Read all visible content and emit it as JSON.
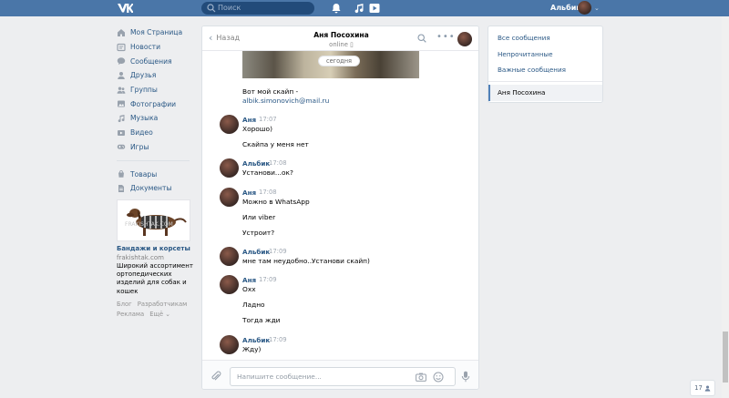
{
  "header": {
    "search_placeholder": "Поиск",
    "user_name": "Альбик"
  },
  "nav": {
    "items": [
      {
        "label": "Моя Страница",
        "icon": "home-icon"
      },
      {
        "label": "Новости",
        "icon": "news-icon"
      },
      {
        "label": "Сообщения",
        "icon": "messages-icon"
      },
      {
        "label": "Друзья",
        "icon": "friends-icon"
      },
      {
        "label": "Группы",
        "icon": "groups-icon"
      },
      {
        "label": "Фотографии",
        "icon": "photos-icon"
      },
      {
        "label": "Музыка",
        "icon": "music-icon"
      },
      {
        "label": "Видео",
        "icon": "video-icon"
      },
      {
        "label": "Игры",
        "icon": "games-icon"
      }
    ],
    "items2": [
      {
        "label": "Товары",
        "icon": "goods-icon"
      },
      {
        "label": "Документы",
        "icon": "documents-icon"
      }
    ]
  },
  "ad": {
    "image_watermark": "FRAKISHTAK.COM",
    "title": "Бандажи и корсеты",
    "domain": "frakishtak.com",
    "text": "Широкий ассортимент ортопедических изделий для собак и кошек"
  },
  "footer": {
    "links": [
      "Блог",
      "Разработчикам",
      "Реклама",
      "Ещё ⌄"
    ]
  },
  "chat": {
    "back_label": "Назад",
    "peer_name": "Аня Посохина",
    "peer_status": "online ▯",
    "date_pill": "сегодня",
    "messages": [
      {
        "text1": "Вот мой скайп -",
        "link": "albik.simonovich@mail.ru"
      },
      {
        "author": "Аня",
        "time": "17:07",
        "lines": [
          "Хорошо)",
          "Скайпа у меня нет"
        ]
      },
      {
        "author": "Альбик",
        "time": "17:08",
        "lines": [
          "Установи...ок?"
        ]
      },
      {
        "author": "Аня",
        "time": "17:08",
        "lines": [
          "Можно в WhatsApp",
          "Или viber",
          "Устроит?"
        ]
      },
      {
        "author": "Альбик",
        "time": "17:09",
        "lines": [
          "мне там неудобно..Установи скайп)"
        ]
      },
      {
        "author": "Аня",
        "time": "17:09",
        "lines": [
          "Охх",
          "Ладно",
          "Тогда жди"
        ]
      },
      {
        "author": "Альбик",
        "time": "17:09",
        "lines": [
          "Жду)"
        ]
      }
    ],
    "composer_placeholder": "Напишите сообщение..."
  },
  "right_panel": {
    "all": "Все сообщения",
    "unread": "Непрочитанные",
    "important": "Важные сообщения",
    "active_dialog": "Аня Посохина"
  },
  "counter": {
    "value": "17"
  },
  "colors": {
    "header": "#4a76a8",
    "link": "#2a5885",
    "background": "#edeef0"
  }
}
